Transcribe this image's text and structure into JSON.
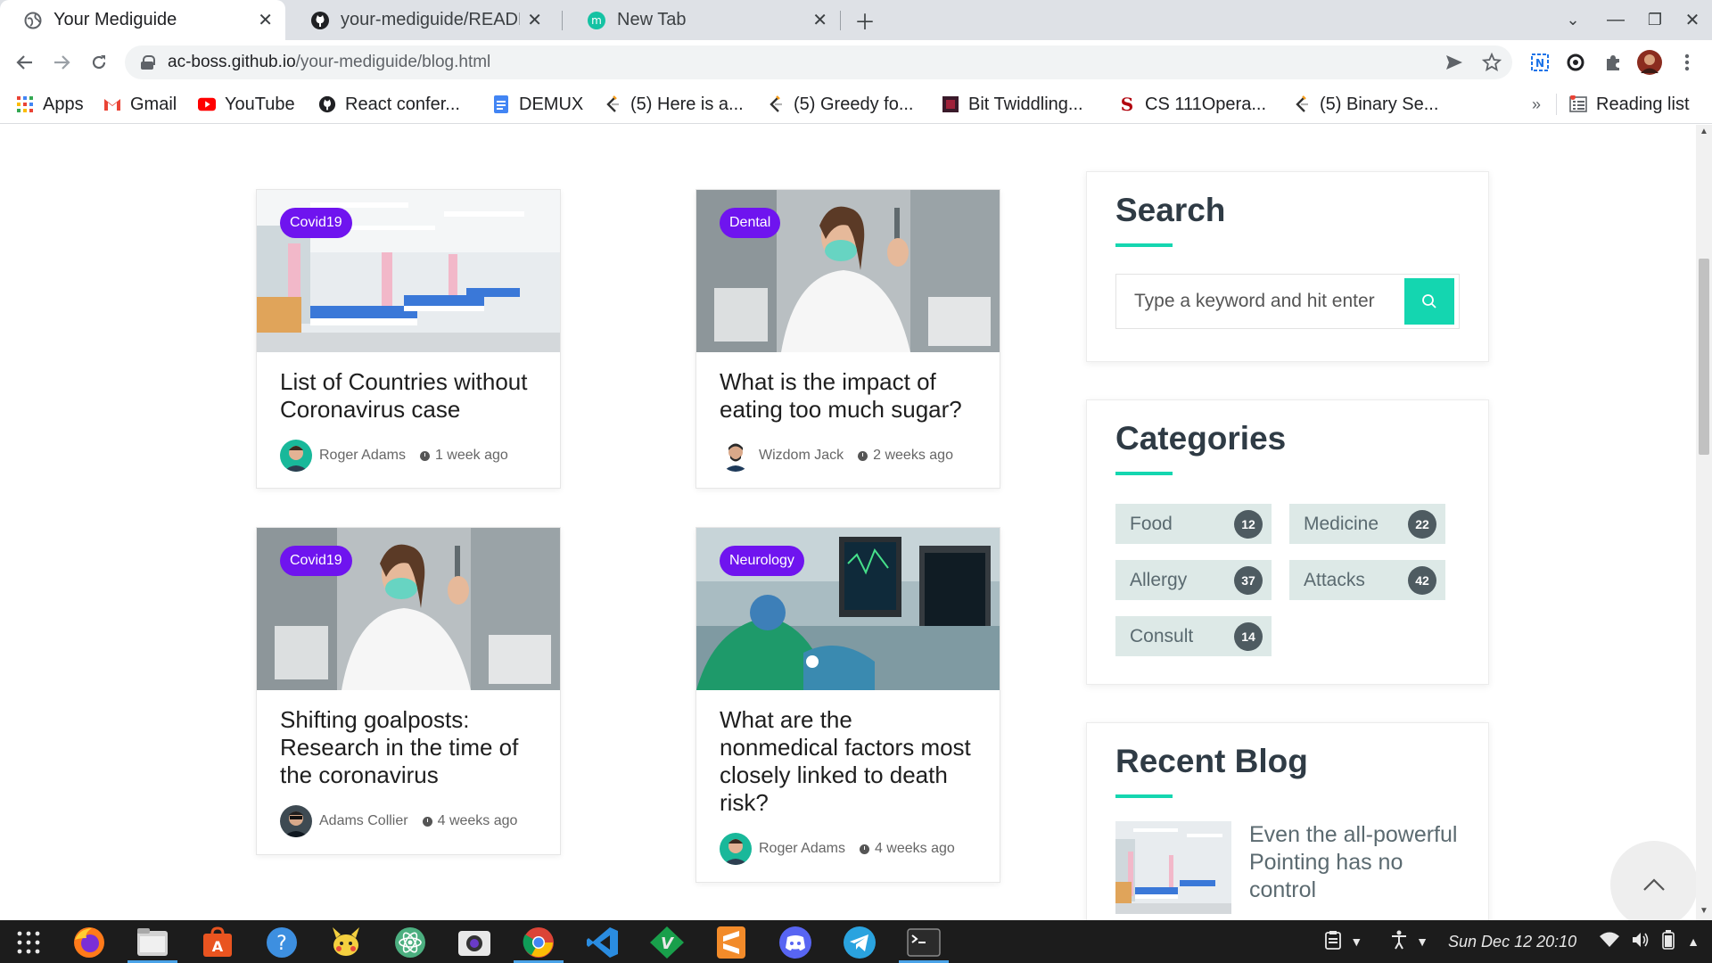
{
  "tabs": [
    {
      "title": "Your Mediguide",
      "active": true
    },
    {
      "title": "your-mediguide/README",
      "active": false
    },
    {
      "title": "New Tab",
      "active": false
    }
  ],
  "address": {
    "host": "ac-boss.github.io",
    "path": "/your-mediguide/blog.html"
  },
  "bookmarks": [
    {
      "label": "Apps",
      "icon": "apps-grid-icon"
    },
    {
      "label": "Gmail",
      "icon": "gmail-icon"
    },
    {
      "label": "YouTube",
      "icon": "youtube-icon"
    },
    {
      "label": "React confer...",
      "icon": "github-icon"
    },
    {
      "label": "DEMUX",
      "icon": "docs-icon"
    },
    {
      "label": "(5) Here is a...",
      "icon": "leetcode-icon"
    },
    {
      "label": "(5) Greedy fo...",
      "icon": "leetcode-icon"
    },
    {
      "label": "Bit Twiddling...",
      "icon": "bookmark-icon"
    },
    {
      "label": "CS 111Opera...",
      "icon": "stanford-icon"
    },
    {
      "label": "(5) Binary Se...",
      "icon": "leetcode-icon"
    }
  ],
  "bookmarks_overflow": "»",
  "reading_list": "Reading list",
  "posts": [
    {
      "badge": "Covid19",
      "title": "List of Countries without Coronavirus case",
      "author": "Roger Adams",
      "time": "1 week ago"
    },
    {
      "badge": "Dental",
      "title": "What is the impact of eating too much sugar?",
      "author": "Wizdom Jack",
      "time": "2 weeks ago"
    },
    {
      "badge": "Covid19",
      "title": "Shifting goalposts: Research in the time of the coronavirus",
      "author": "Adams Collier",
      "time": "4 weeks ago"
    },
    {
      "badge": "Neurology",
      "title": "What are the nonmedical factors most closely linked to death risk?",
      "author": "Roger Adams",
      "time": "4 weeks ago"
    }
  ],
  "sidebar": {
    "search_title": "Search",
    "search_placeholder": "Type a keyword and hit enter",
    "categories_title": "Categories",
    "categories": [
      {
        "name": "Food",
        "count": "12"
      },
      {
        "name": "Medicine",
        "count": "22"
      },
      {
        "name": "Allergy",
        "count": "37"
      },
      {
        "name": "Attacks",
        "count": "42"
      },
      {
        "name": "Consult",
        "count": "14"
      }
    ],
    "recent_title": "Recent Blog",
    "recent_items": [
      {
        "title": "Even the all-powerful Pointing has no control"
      }
    ]
  },
  "taskbar": {
    "apps": [
      "apps-grid-icon",
      "firefox-icon",
      "files-icon",
      "software-center-icon",
      "help-icon",
      "pokemon-icon",
      "atom-icon",
      "camera-icon",
      "chrome-icon",
      "vscode-icon",
      "vim-icon",
      "sublime-icon",
      "discord-icon",
      "telegram-icon",
      "terminal-icon"
    ],
    "clock": "Sun Dec 12  20:10"
  },
  "colors": {
    "accent": "#14d6b0",
    "badge": "#6f14ef",
    "category_bg": "#dde9e7",
    "count_bg": "#4e5b61"
  }
}
